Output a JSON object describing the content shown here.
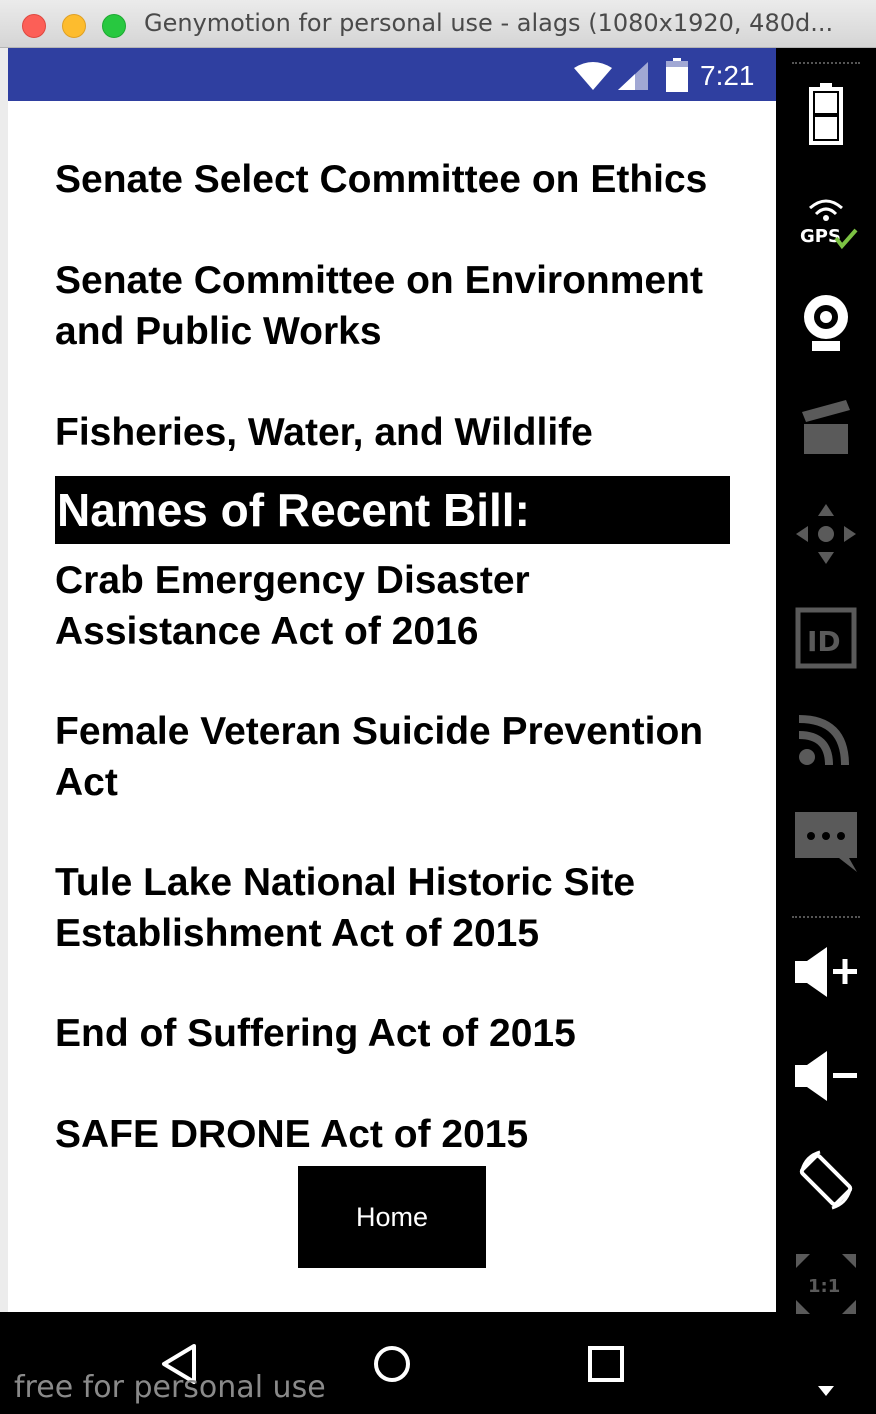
{
  "window": {
    "title": "Genymotion for personal use - alags (1080x1920, 480d..."
  },
  "status_bar": {
    "time": "7:21"
  },
  "committees": [
    "Senate Select Committee on Ethics",
    "Senate Committee on Environment and Public Works",
    "Fisheries, Water, and Wildlife"
  ],
  "bills_section": {
    "header": "Names of Recent Bill:",
    "items": [
      "Crab Emergency Disaster Assistance Act of 2016",
      "Female Veteran Suicide Prevention Act",
      "Tule Lake National Historic Site Establishment Act of 2015",
      "End of Suffering Act of 2015",
      "SAFE DRONE Act of 2015"
    ]
  },
  "home_button": {
    "label": "Home"
  },
  "sidebar": {
    "gps_label": "GPS",
    "id_label": "ID",
    "zoom_label": "1:1"
  },
  "watermark": "free for personal use",
  "colors": {
    "status_bar": "#2f3fa0",
    "header_bg": "#000000",
    "button_bg": "#000000"
  }
}
